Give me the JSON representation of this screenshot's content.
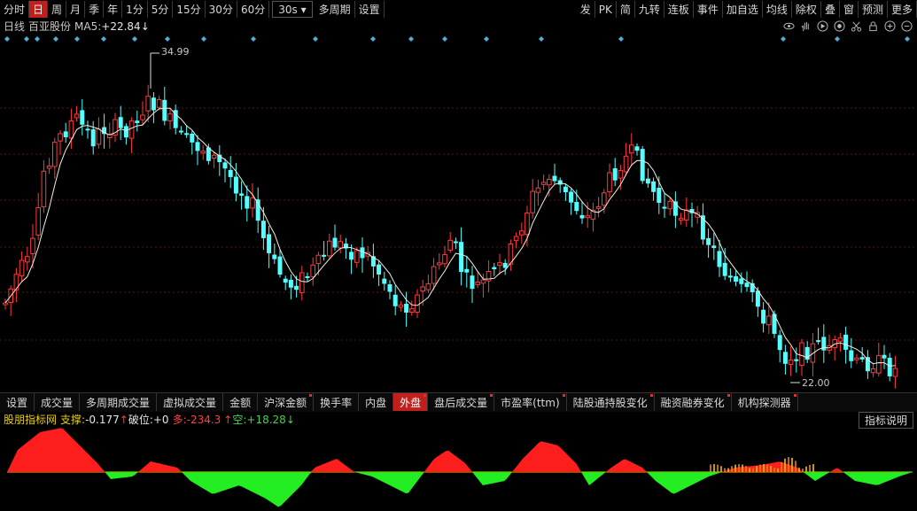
{
  "toolbar": {
    "left": [
      "分时",
      "日",
      "周",
      "月",
      "季",
      "年",
      "1分",
      "5分",
      "15分",
      "30分",
      "60分"
    ],
    "active": "日",
    "period_dropdown": "30s",
    "multi_period": "多周期",
    "settings": "设置",
    "right": [
      "发",
      "PK",
      "简",
      "九转",
      "连板",
      "事件",
      "加自选",
      "均线",
      "除权",
      "叠",
      "窗",
      "预测",
      "更多"
    ]
  },
  "info": {
    "period": "日线",
    "stock_name": "百亚股份",
    "ma_label": "MA5:",
    "ma_value": "+22.84",
    "ma_arrow": "↓"
  },
  "price_labels": {
    "high": "34.99",
    "low": "22.00"
  },
  "tabs": [
    "设置",
    "成交量",
    "多周期成交量",
    "虚拟成交量",
    "金额",
    "沪深金额",
    "换手率",
    "内盘",
    "外盘",
    "盘后成交量",
    "市盈率(ttm)",
    "陆股通持股变化",
    "融资融券变化",
    "机构探测器"
  ],
  "active_tab": "外盘",
  "indicator": {
    "name": "股朋指标网",
    "support_label": "支撑:",
    "support_value": "-0.177",
    "break_arrow": "↑",
    "break_label": "破位:",
    "break_value": "+0",
    "long_label": "多:",
    "long_value": "-234.3",
    "short_arrow": "↑",
    "short_label": "空:",
    "short_value": "+18.28",
    "short_dir": "↓",
    "explain": "指标说明"
  },
  "colors": {
    "up": "#ff3b3b",
    "down": "#54ffff",
    "ma": "#f0f0e0",
    "red_area": "#ff1e1e",
    "green_area": "#22ee22"
  }
}
